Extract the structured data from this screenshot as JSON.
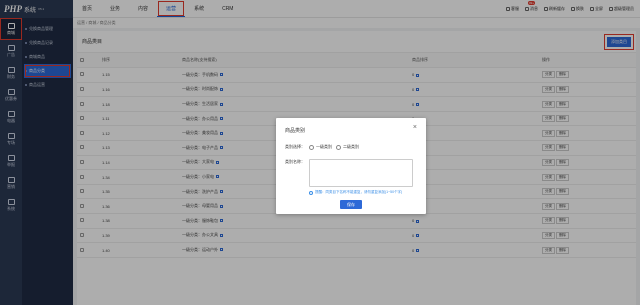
{
  "brand": {
    "logo_text": "PHP",
    "name": "系统",
    "version": "V5.1"
  },
  "rail": [
    {
      "label": "商城",
      "icon": "shop-icon",
      "active": true
    },
    {
      "label": "广告",
      "icon": "ad-icon"
    },
    {
      "label": "财务",
      "icon": "finance-icon"
    },
    {
      "label": "优惠券",
      "icon": "coupon-icon"
    },
    {
      "label": "电器",
      "icon": "appliance-icon"
    },
    {
      "label": "专场",
      "icon": "special-icon"
    },
    {
      "label": "举报",
      "icon": "report-icon"
    },
    {
      "label": "营销",
      "icon": "marketing-icon"
    },
    {
      "label": "系统",
      "icon": "system-icon"
    }
  ],
  "subnav": [
    {
      "label": "兑换商品管理"
    },
    {
      "label": "兑换商品记录"
    },
    {
      "label": "商城商品"
    },
    {
      "label": "商品分类",
      "active": true
    },
    {
      "label": "商品运营"
    }
  ],
  "topnav": [
    {
      "label": "首页"
    },
    {
      "label": "业务"
    },
    {
      "label": "内容"
    },
    {
      "label": "运营",
      "active": true
    },
    {
      "label": "系统"
    },
    {
      "label": "CRM"
    }
  ],
  "top_right": [
    {
      "label": "客服",
      "icon": "service-icon"
    },
    {
      "label": "消息",
      "icon": "bell-icon",
      "badge": "99+"
    },
    {
      "label": "刷新缓存",
      "icon": "refresh-icon"
    },
    {
      "label": "换肤",
      "icon": "skin-icon"
    },
    {
      "label": "全屏",
      "icon": "fullscreen-icon"
    },
    {
      "label": "超级管理员",
      "icon": "user-icon"
    }
  ],
  "breadcrumb": "运营 / 商城 / 商品分类",
  "panel": {
    "title": "商品类目",
    "add_label": "添加类目",
    "columns": [
      "",
      "排序",
      "商品名称(支持搜索)",
      "商品排序",
      "操作"
    ],
    "rows": [
      {
        "id": "1.15",
        "name": "一级分类：手机数码",
        "sort": "0"
      },
      {
        "id": "1.16",
        "name": "一级分类：时尚配饰",
        "sort": "0"
      },
      {
        "id": "1.18",
        "name": "一级分类：生活居家",
        "sort": "0"
      },
      {
        "id": "1.11",
        "name": "一级分类：办公用品",
        "sort": "0"
      },
      {
        "id": "1.12",
        "name": "一级分类：美妆用品",
        "sort": "0"
      },
      {
        "id": "1.13",
        "name": "一级分类：电子产品",
        "sort": "0"
      },
      {
        "id": "1.14",
        "name": "一级分类：大家电",
        "sort": "0"
      },
      {
        "id": "1.34",
        "name": "一级分类：小家电",
        "sort": "0"
      },
      {
        "id": "1.35",
        "name": "一级分类：洗护产品",
        "sort": "0"
      },
      {
        "id": "1.36",
        "name": "一级分类：母婴用品",
        "sort": "0"
      },
      {
        "id": "1.38",
        "name": "一级分类：服饰鞋包",
        "sort": "0"
      },
      {
        "id": "1.39",
        "name": "一级分类：办公文具",
        "sort": "0"
      },
      {
        "id": "1.40",
        "name": "一级分类：运动户外",
        "sort": "0"
      }
    ],
    "op_labels": [
      "分类",
      "删除"
    ]
  },
  "modal": {
    "title": "商品类别",
    "close": "×",
    "type_label": "类别选择：",
    "option_a": "一级类别",
    "option_b": "二级类别",
    "name_label": "类别名称：",
    "name_value": "",
    "tip": "提醒：同类目下名称不能重复，请勿重复添加(1~50个字)",
    "save_label": "保存"
  }
}
